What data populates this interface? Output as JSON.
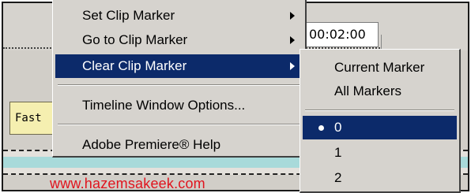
{
  "timeline": {
    "timecode": "00:02:00",
    "clip_label": "Fast"
  },
  "watermark": "www.hazemsakeek.com",
  "context_menu": {
    "items": [
      {
        "label": "Set Clip Marker",
        "has_submenu": true
      },
      {
        "label": "Go to Clip Marker",
        "has_submenu": true
      },
      {
        "label": "Clear Clip Marker",
        "has_submenu": true,
        "selected": true
      },
      {
        "label": "Timeline Window Options...",
        "has_submenu": false
      },
      {
        "label": "Adobe Premiere® Help",
        "has_submenu": false
      }
    ]
  },
  "submenu": {
    "items": [
      {
        "label": "Current Marker"
      },
      {
        "label": "All Markers"
      },
      {
        "label": "0",
        "selected": true,
        "checked": true
      },
      {
        "label": "1"
      },
      {
        "label": "2"
      }
    ]
  },
  "colors": {
    "selection": "#0c2a6a",
    "menu_bg": "#d6d3ce",
    "watermark": "#e0141e",
    "clip_fill": "#f5efb0",
    "track_teal": "#a8dada"
  }
}
